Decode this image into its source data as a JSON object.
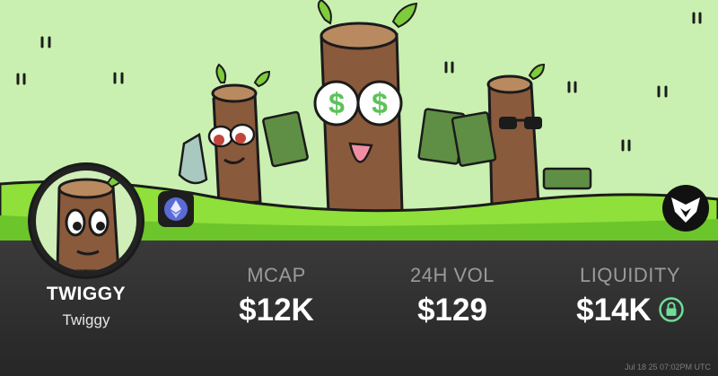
{
  "token": {
    "symbol": "TWIGGY",
    "name": "Twiggy"
  },
  "stats": {
    "mcap": {
      "label": "MCAP",
      "value": "$12K"
    },
    "volume": {
      "label": "24H VOL",
      "value": "$129"
    },
    "liquidity": {
      "label": "LIQUIDITY",
      "value": "$14K",
      "locked": true
    }
  },
  "timestamp": "Jul 18 25 07:02PM UTC",
  "chain_icon": "ethereum-icon",
  "brand_icon": "eagle-icon",
  "colors": {
    "sky": "#c9f0b0",
    "grass": "#8fe03a",
    "panel": "#2b2b2b",
    "label": "#9a9a9a",
    "value": "#ffffff",
    "lock": "#6fdc9a"
  }
}
